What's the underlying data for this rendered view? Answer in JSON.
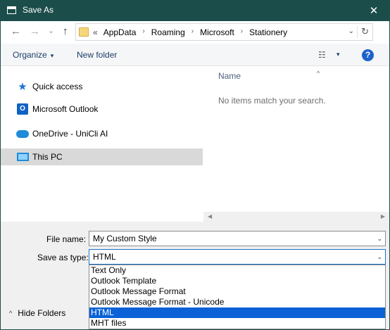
{
  "window": {
    "title": "Save As",
    "close_glyph": "✕",
    "app_icon": "window-icon"
  },
  "nav": {
    "back_glyph": "←",
    "forward_glyph": "→",
    "recent_glyph": "⌄",
    "up_glyph": "↑",
    "address": {
      "prefix": "«",
      "crumbs": [
        "AppData",
        "Roaming",
        "Microsoft",
        "Stationery"
      ],
      "separator": "›",
      "dropdown_glyph": "⌄",
      "refresh_glyph": "↻"
    }
  },
  "toolbar": {
    "organize_label": "Organize",
    "organize_caret": "▾",
    "new_folder_label": "New folder",
    "view_glyph": "☷",
    "view_caret": "▾",
    "help_glyph": "?"
  },
  "navigation_pane": {
    "items": [
      {
        "label": "Quick access",
        "icon": "star-icon",
        "glyph": "★"
      },
      {
        "label": "Microsoft Outlook",
        "icon": "outlook-icon",
        "glyph": "O"
      },
      {
        "label": "OneDrive - UniCli AI",
        "icon": "cloud-icon"
      },
      {
        "label": "This PC",
        "icon": "computer-icon",
        "selected": true
      }
    ]
  },
  "content": {
    "column_header": "Name",
    "sort_glyph": "^",
    "empty_message": "No items match your search.",
    "scroll_left_glyph": "◀",
    "scroll_right_glyph": "▶"
  },
  "form": {
    "file_name_label": "File name:",
    "file_name_value": "My Custom Style",
    "save_as_type_label": "Save as type:",
    "save_as_type_value": "HTML",
    "chevron_glyph": "⌄",
    "type_options": [
      "Text Only",
      "Outlook Template",
      "Outlook Message Format",
      "Outlook Message Format - Unicode",
      "HTML",
      "MHT files"
    ],
    "selected_option_index": 4,
    "hide_folders_label": "Hide Folders",
    "hide_folders_glyph": "^"
  },
  "colors": {
    "titlebar": "#1b4d4a",
    "accent": "#0a62d6",
    "help": "#1c63c9"
  }
}
